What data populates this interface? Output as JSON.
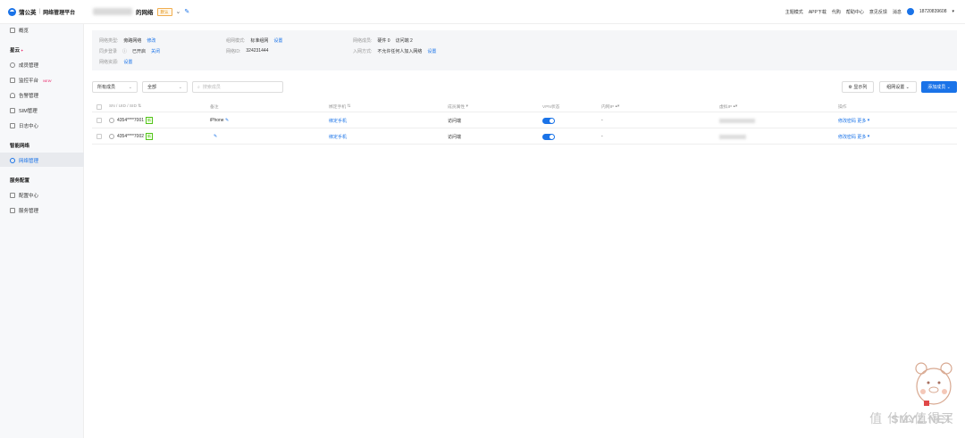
{
  "header": {
    "app_name": "蒲公英",
    "separator": "|",
    "app_subtitle": "网络管理平台",
    "network_name_suffix": "的网络",
    "default_tag": "默认",
    "right_links": [
      "主题模式",
      "APP下载",
      "代购",
      "帮助中心",
      "意见反馈",
      "消息"
    ],
    "phone": "18720839608"
  },
  "sidebar": {
    "overview": "概览",
    "group_cloud": "星云",
    "items_cloud": [
      "成员管理",
      "监控平台",
      "告警管理",
      "SIM管理",
      "日志中心"
    ],
    "monitor_badge": "NEW",
    "group_smart": "智能网络",
    "network_mgmt": "网络管理",
    "group_service": "服务配置",
    "items_service": [
      "配置中心",
      "服务管理"
    ]
  },
  "info": {
    "row1": [
      {
        "label": "网络类型:",
        "value": "旁路网络",
        "link": "修改"
      },
      {
        "label": "组网模式:",
        "value": "标准组网",
        "link": "设置"
      },
      {
        "label": "网络成员:",
        "value": "硬件 0",
        "value2": "访问端 2"
      }
    ],
    "row2": [
      {
        "label": "同步登录",
        "value": "已开启",
        "link": "关闭"
      },
      {
        "label": "网络ID:",
        "value": "324231444"
      },
      {
        "label": "入网方式:",
        "value": "不允许任何人加入网络",
        "link": "设置"
      }
    ],
    "row3": {
      "label": "网络资源:",
      "link": "设置"
    }
  },
  "toolbar": {
    "filter_members": "所有成员",
    "filter_all": "全部",
    "search_placeholder": "搜索成员",
    "show_columns": "显示列",
    "batch_settings": "组网设置",
    "add_member": "添加成员"
  },
  "table": {
    "headers": [
      "SN / UID / SID",
      "备注",
      "绑定手机",
      "成员属性",
      "VPN状态",
      "内网IP",
      "虚拟IP",
      "操作"
    ],
    "rows": [
      {
        "id": "4354****7001",
        "tag": "新",
        "remark": "iPhone",
        "phone": "绑定手机",
        "attr": "访问端",
        "ip": "-",
        "op1": "修改密码",
        "op2": "更多"
      },
      {
        "id": "4354****7002",
        "tag": "新",
        "remark": "",
        "phone": "绑定手机",
        "attr": "访问端",
        "ip": "-",
        "op1": "修改密码",
        "op2": "更多"
      }
    ]
  },
  "watermark": {
    "cn": "值 什么值得买",
    "en": "SMYZ.NET"
  }
}
